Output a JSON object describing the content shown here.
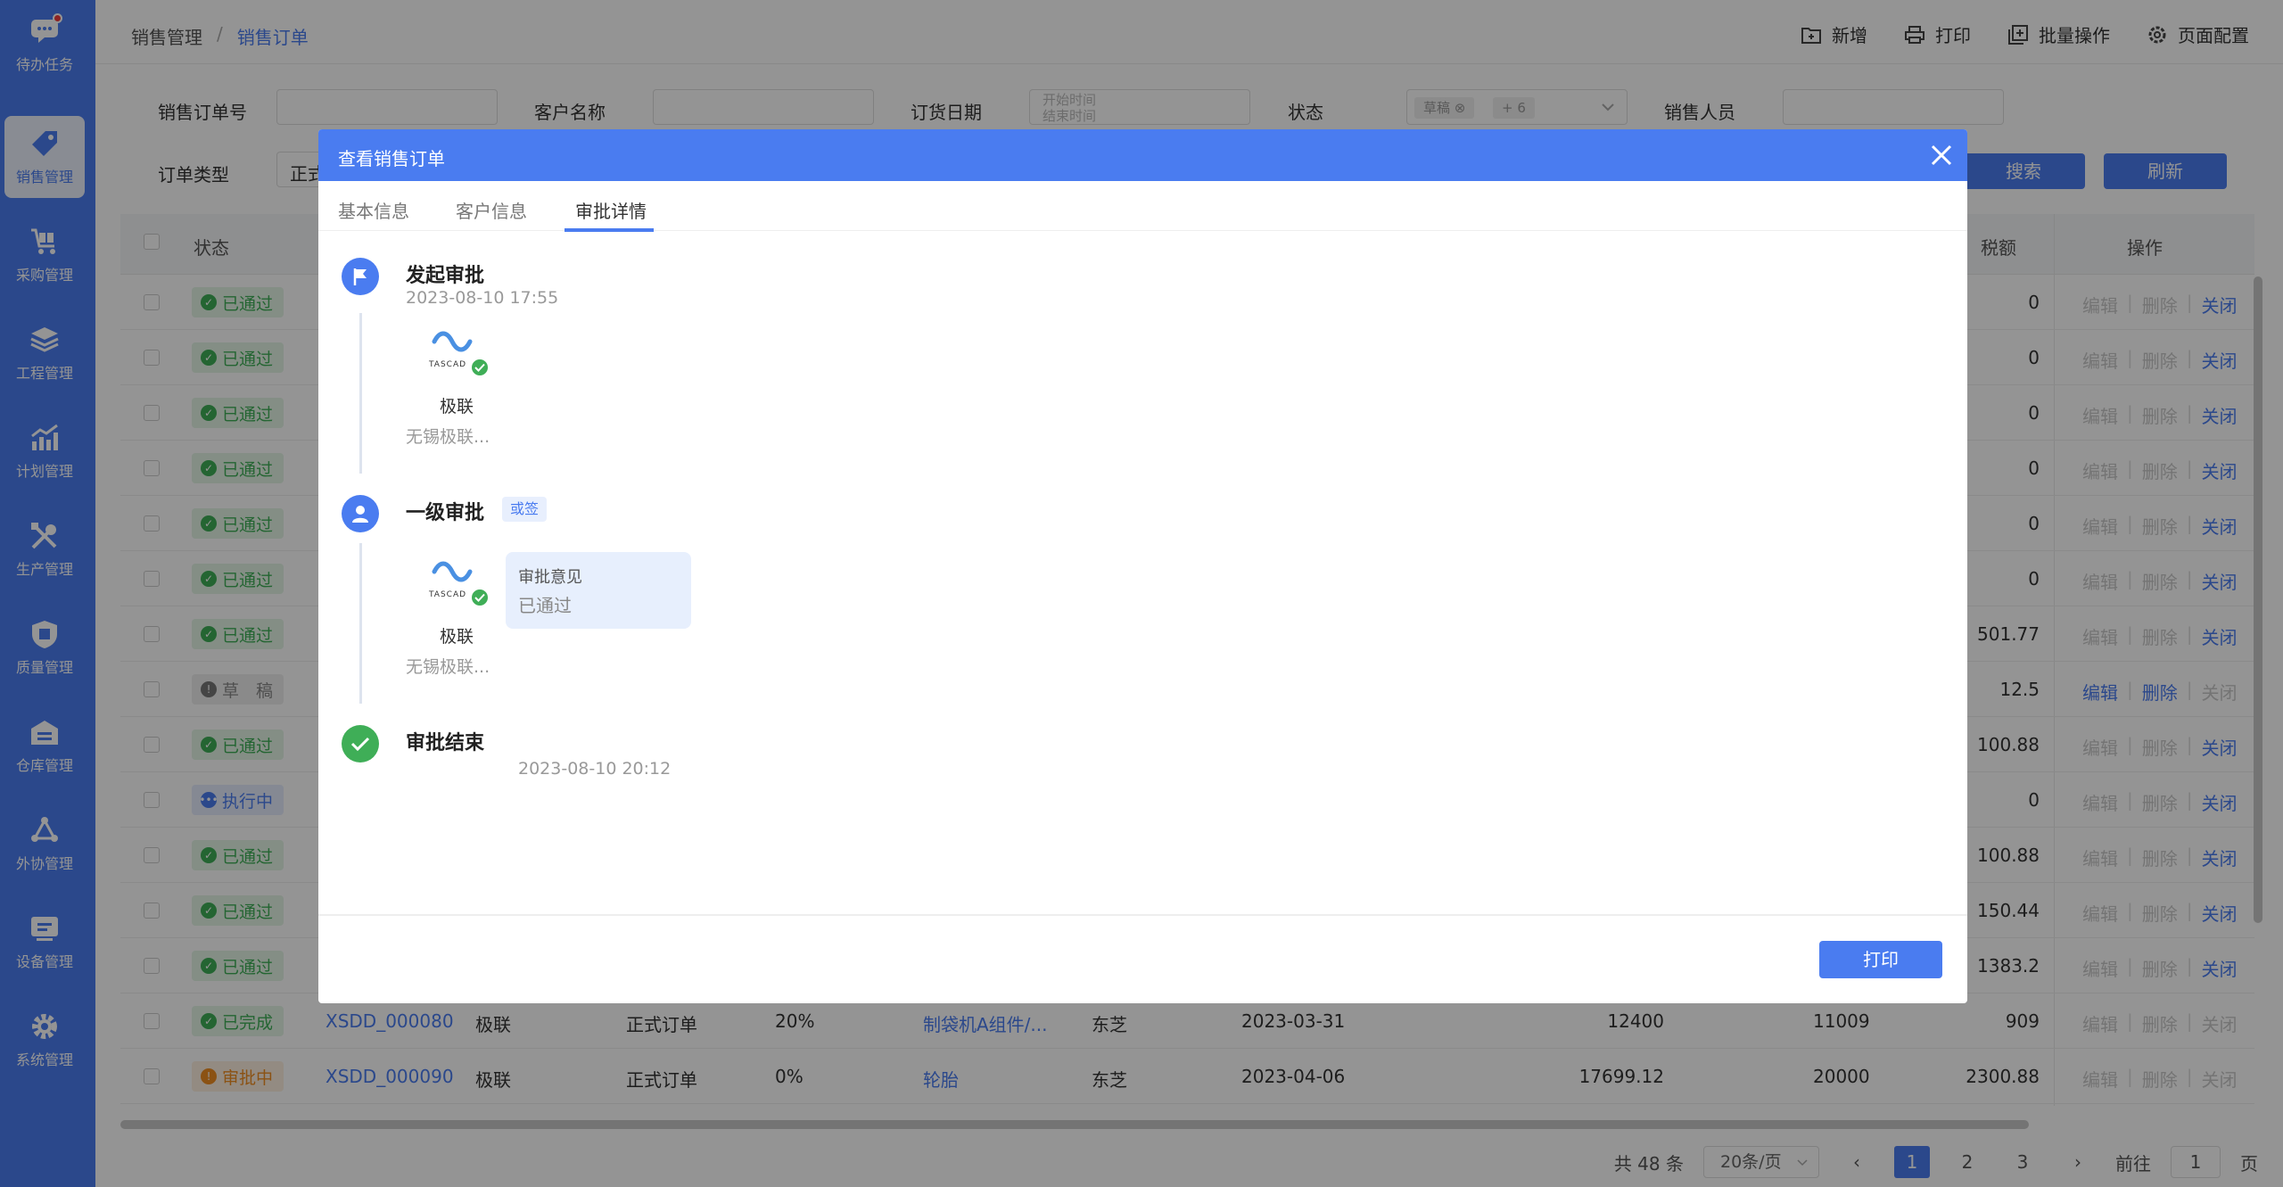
{
  "sidebar": {
    "items": [
      {
        "label": "待办任务",
        "icon": "chat-icon"
      },
      {
        "label": "销售管理",
        "icon": "tag-icon"
      },
      {
        "label": "采购管理",
        "icon": "cart-icon"
      },
      {
        "label": "工程管理",
        "icon": "layers-icon"
      },
      {
        "label": "计划管理",
        "icon": "chart-icon"
      },
      {
        "label": "生产管理",
        "icon": "tools-icon"
      },
      {
        "label": "质量管理",
        "icon": "quality-shield-icon"
      },
      {
        "label": "仓库管理",
        "icon": "warehouse-icon"
      },
      {
        "label": "外协管理",
        "icon": "network-icon"
      },
      {
        "label": "设备管理",
        "icon": "device-icon"
      },
      {
        "label": "系统管理",
        "icon": "gear-icon"
      }
    ]
  },
  "header": {
    "breadcrumb": [
      "销售管理",
      "销售订单"
    ],
    "breadcrumb_sep": "/",
    "actions": [
      {
        "label": "新增",
        "icon": "folder-plus-icon"
      },
      {
        "label": "打印",
        "icon": "printer-icon"
      },
      {
        "label": "批量操作",
        "icon": "batch-icon"
      },
      {
        "label": "页面配置",
        "icon": "settings-icon"
      }
    ]
  },
  "filters": {
    "order_no_label": "销售订单号",
    "customer_label": "客户名称",
    "date_label": "订货日期",
    "date_start_placeholder": "开始时间",
    "date_end_placeholder": "结束时间",
    "status_label": "状态",
    "status_tag": "草稿",
    "status_more": "+ 6",
    "sales_label": "销售人员",
    "type_label": "订单类型",
    "type_value": "正式",
    "search_btn": "搜索",
    "refresh_btn": "刷新"
  },
  "table": {
    "headers": {
      "status": "状态",
      "tax": "税额",
      "ops": "操作"
    },
    "rows": [
      {
        "status": "已通过",
        "kind": "pass",
        "tax": "0",
        "edit": "编辑",
        "del": "删除",
        "close": "关闭",
        "editable": false,
        "closable": true
      },
      {
        "status": "已通过",
        "kind": "pass",
        "tax": "0",
        "edit": "编辑",
        "del": "删除",
        "close": "关闭",
        "editable": false,
        "closable": true
      },
      {
        "status": "已通过",
        "kind": "pass",
        "tax": "0",
        "edit": "编辑",
        "del": "删除",
        "close": "关闭",
        "editable": false,
        "closable": true
      },
      {
        "status": "已通过",
        "kind": "pass",
        "tax": "0",
        "edit": "编辑",
        "del": "删除",
        "close": "关闭",
        "editable": false,
        "closable": true
      },
      {
        "status": "已通过",
        "kind": "pass",
        "tax": "0",
        "edit": "编辑",
        "del": "删除",
        "close": "关闭",
        "editable": false,
        "closable": true
      },
      {
        "status": "已通过",
        "kind": "pass",
        "tax": "0",
        "edit": "编辑",
        "del": "删除",
        "close": "关闭",
        "editable": false,
        "closable": true
      },
      {
        "status": "已通过",
        "kind": "pass",
        "tax": "501.77",
        "edit": "编辑",
        "del": "删除",
        "close": "关闭",
        "editable": false,
        "closable": true
      },
      {
        "status": "草　稿",
        "kind": "draft",
        "tax": "12.5",
        "edit": "编辑",
        "del": "删除",
        "close": "关闭",
        "editable": true,
        "closable": false
      },
      {
        "status": "已通过",
        "kind": "pass",
        "tax": "100.88",
        "edit": "编辑",
        "del": "删除",
        "close": "关闭",
        "editable": false,
        "closable": true
      },
      {
        "status": "执行中",
        "kind": "run",
        "tax": "0",
        "edit": "编辑",
        "del": "删除",
        "close": "关闭",
        "editable": false,
        "closable": true
      },
      {
        "status": "已通过",
        "kind": "pass",
        "tax": "100.88",
        "edit": "编辑",
        "del": "删除",
        "close": "关闭",
        "editable": false,
        "closable": true
      },
      {
        "status": "已通过",
        "kind": "pass",
        "tax": "150.44",
        "edit": "编辑",
        "del": "删除",
        "close": "关闭",
        "editable": false,
        "closable": true
      },
      {
        "status": "已通过",
        "kind": "pass",
        "tax": "1383.2",
        "edit": "编辑",
        "del": "删除",
        "close": "关闭",
        "editable": false,
        "closable": true
      },
      {
        "status": "已完成",
        "kind": "done",
        "order": "XSDD_000080",
        "customer": "极联",
        "type": "正式订单",
        "pct": "20%",
        "product": "制袋机A组件/...",
        "vendor": "东芝",
        "date": "2023-03-31",
        "amount": "12400",
        "qty": "11009",
        "tax": "909",
        "edit": "编辑",
        "del": "删除",
        "close": "关闭",
        "editable": false,
        "closable": false
      },
      {
        "status": "审批中",
        "kind": "aud",
        "order": "XSDD_000090",
        "customer": "极联",
        "type": "正式订单",
        "pct": "0%",
        "product": "轮胎",
        "vendor": "东芝",
        "date": "2023-04-06",
        "amount": "17699.12",
        "qty": "20000",
        "tax": "2300.88",
        "edit": "编辑",
        "del": "删除",
        "close": "关闭",
        "editable": false,
        "closable": false
      }
    ]
  },
  "pagination": {
    "total": "共 48 条",
    "page_size": "20条/页",
    "pages": [
      "1",
      "2",
      "3"
    ],
    "current": "1",
    "goto_label": "前往",
    "goto_value": "1",
    "page_unit": "页"
  },
  "modal": {
    "title": "查看销售订单",
    "tabs": [
      "基本信息",
      "客户信息",
      "审批详情"
    ],
    "active_tab": "审批详情",
    "timeline": {
      "start": {
        "title": "发起审批",
        "time": "2023-08-10 17:55",
        "user_name": "极联",
        "user_org": "无锡极联..."
      },
      "level1": {
        "title": "一级审批",
        "tag": "或签",
        "user_name": "极联",
        "user_org": "无锡极联...",
        "comment_label": "审批意见",
        "comment_value": "已通过",
        "comment_time": "2023-08-10 20:12"
      },
      "end": {
        "title": "审批结束"
      }
    },
    "print_btn": "打印"
  },
  "colors": {
    "primary": "#4a7cf0",
    "success": "#3fae57",
    "warning": "#ef8d22"
  }
}
